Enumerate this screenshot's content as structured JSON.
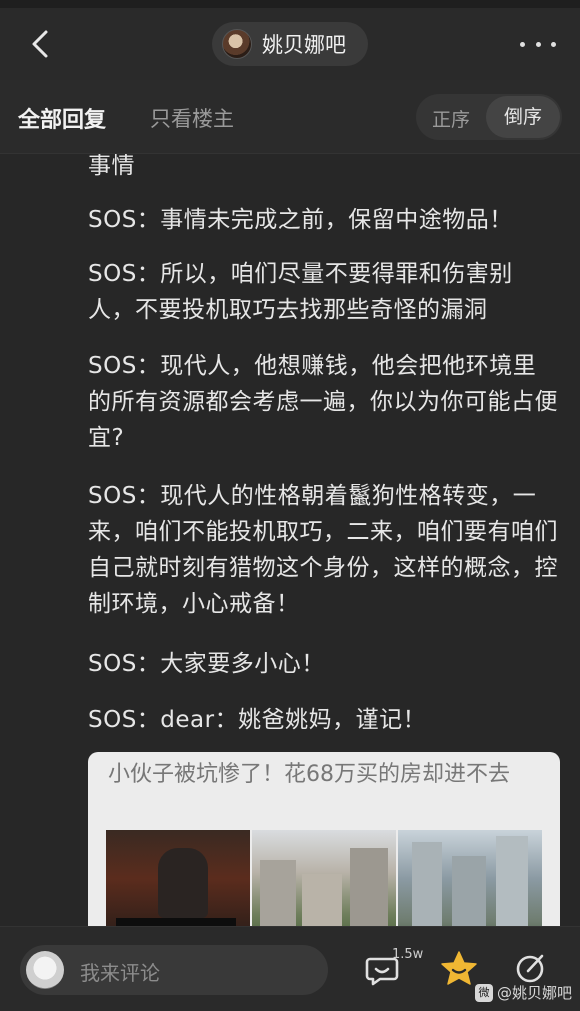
{
  "navbar": {
    "forum_name": "姚贝娜吧",
    "back_icon": "chevron-left-icon",
    "more_icon": "more-dots-icon"
  },
  "tabs": {
    "all_replies": "全部回复",
    "owner_only": "只看楼主",
    "sort_asc": "正序",
    "sort_desc": "倒序",
    "active_sort": "倒序"
  },
  "post": {
    "paragraphs": [
      "事情",
      "SOS：事情未完成之前，保留中途物品！",
      "SOS：所以，咱们尽量不要得罪和伤害别人，不要投机取巧去找那些奇怪的漏洞",
      "SOS：现代人，他想赚钱，他会把他环境里的所有资源都会考虑一遍，你以为你可能占便宜?",
      "SOS：现代人的性格朝着鬣狗性格转变，一来，咱们不能投机取巧，二来，咱们要有咱们自己就时刻有猎物这个身份，这样的概念，控制环境，小心戒备！",
      "SOS：大家要多小心！",
      "SOS：dear：姚爸姚妈，谨记！"
    ],
    "link_card": {
      "title": "小伙子被坑惨了！花68万买的房却进不去"
    }
  },
  "bottom": {
    "comment_placeholder": "我来评论",
    "reply_count": "1.5w",
    "watermark": "@姚贝娜吧",
    "watermark_logo": "微"
  },
  "colors": {
    "background": "#272727",
    "star": "#f0b733",
    "text": "#e6e6e6"
  }
}
